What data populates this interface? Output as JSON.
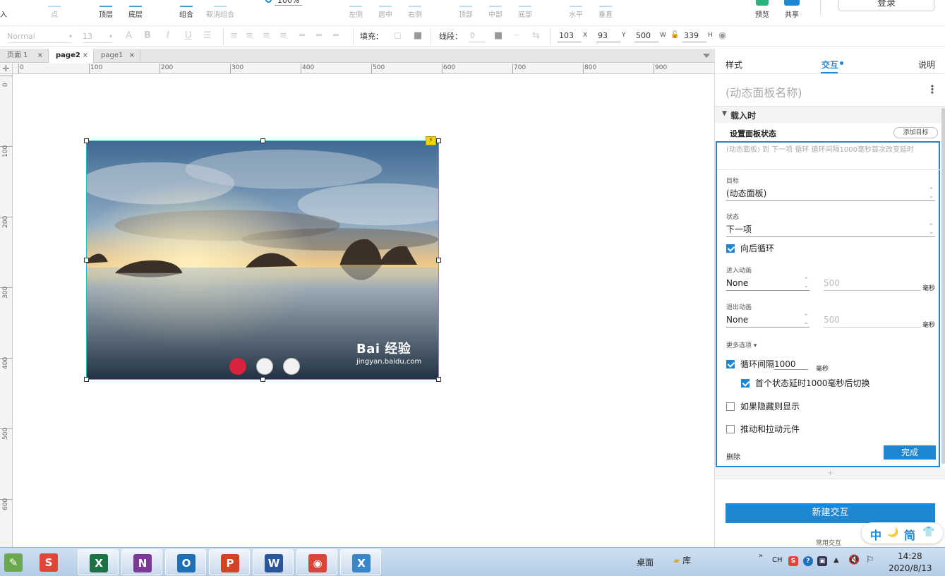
{
  "toolbar": {
    "left_cut_label": "入",
    "point_label": "点",
    "top_layer_label": "顶层",
    "bottom_layer_label": "底层",
    "group_label": "组合",
    "ungroup_label": "取消组合",
    "zoom_value": "100%",
    "align_left_label": "左侧",
    "align_center_label": "居中",
    "align_right_label": "右侧",
    "align_top_label": "顶部",
    "align_middle_label": "中部",
    "align_bottom_label": "底部",
    "distribute_h_label": "水平",
    "distribute_v_label": "垂直",
    "preview_label": "预览",
    "share_label": "共享",
    "login_label": "登录"
  },
  "format_bar": {
    "style_value": "Normal",
    "font_size_value": "13",
    "fill_label": "填充：",
    "stroke_label": "线段：",
    "stroke_value": "0",
    "x_value": "103",
    "x_axis": "X",
    "y_value": "93",
    "y_axis": "Y",
    "w_value": "500",
    "w_axis": "W",
    "h_value": "339",
    "h_axis": "H"
  },
  "tabs": [
    {
      "label": "页面 1",
      "close": "×"
    },
    {
      "label": "page2",
      "close": "×"
    },
    {
      "label": "page1",
      "close": "×"
    }
  ],
  "ruler": {
    "h_labels": [
      "0",
      "100",
      "200",
      "300",
      "400",
      "500",
      "600",
      "700",
      "800",
      "900"
    ],
    "v_labels": [
      "0",
      "100",
      "200",
      "300",
      "400",
      "500",
      "600"
    ]
  },
  "canvas": {
    "flash_icon": "⚡",
    "watermark_title": "Bai 经验",
    "watermark_sub": "jingyan.baidu.com",
    "dot_colors": [
      "#d9223b",
      "#f2f2f2",
      "#f2f2f2"
    ]
  },
  "right_panel": {
    "tab_style": "样式",
    "tab_interaction": "交互",
    "tab_notes": "说明",
    "panel_name_placeholder": "(动态面板名称)",
    "more_icon": "⋮",
    "section_title": "载入时",
    "action_title": "设置面板状态",
    "add_target_label": "添加目标",
    "action_desc": "(动态面板) 到 下一项 循环 循环间隔1000毫秒首次改变延时",
    "target_label": "目标",
    "target_value": "(动态面板)",
    "state_label": "状态",
    "state_value": "下一项",
    "loop_back_label": "向后循环",
    "enter_anim_label": "进入动画",
    "enter_anim_value": "None",
    "enter_anim_duration": "500",
    "exit_anim_label": "退出动画",
    "exit_anim_value": "None",
    "exit_anim_duration": "500",
    "ms_unit": "毫秒",
    "more_options_label": "更多选项",
    "more_options_caret": "▾",
    "interval_label": "循环间隔",
    "interval_value": "1000",
    "first_delay_label": "首个状态延时1000毫秒后切换",
    "show_if_hidden_label": "如果隐藏则显示",
    "push_pull_label": "推动和拉动元件",
    "delete_label": "删除",
    "done_label": "完成",
    "plus": "+",
    "new_interaction_label": "新建交互",
    "common_interaction_label": "常用交互",
    "spin_glyph": "⌃⌄"
  },
  "ime": {
    "zhong": "中",
    "moon": "🌙",
    "jian": "简",
    "shirt": "👕"
  },
  "taskbar": {
    "apps": [
      {
        "name": "Paint",
        "glyph": "✎",
        "color": "#6aa84f"
      },
      {
        "name": "Sogou",
        "glyph": "S",
        "color": "#e0453a"
      },
      {
        "name": "Excel",
        "glyph": "X",
        "color": "#1e7145"
      },
      {
        "name": "OneNote",
        "glyph": "N",
        "color": "#7b3a96"
      },
      {
        "name": "Outlook",
        "glyph": "O",
        "color": "#1f6fb5"
      },
      {
        "name": "PowerPoint",
        "glyph": "P",
        "color": "#d04423"
      },
      {
        "name": "Word",
        "glyph": "W",
        "color": "#2b579a"
      },
      {
        "name": "Chrome",
        "glyph": "◉",
        "color": "#db4437"
      },
      {
        "name": "Axure",
        "glyph": "X",
        "color": "#3a86c8"
      }
    ],
    "desktop_label": "桌面",
    "library_label": "库",
    "lang_label": "CH",
    "time": "14:28",
    "date": "2020/8/13"
  }
}
